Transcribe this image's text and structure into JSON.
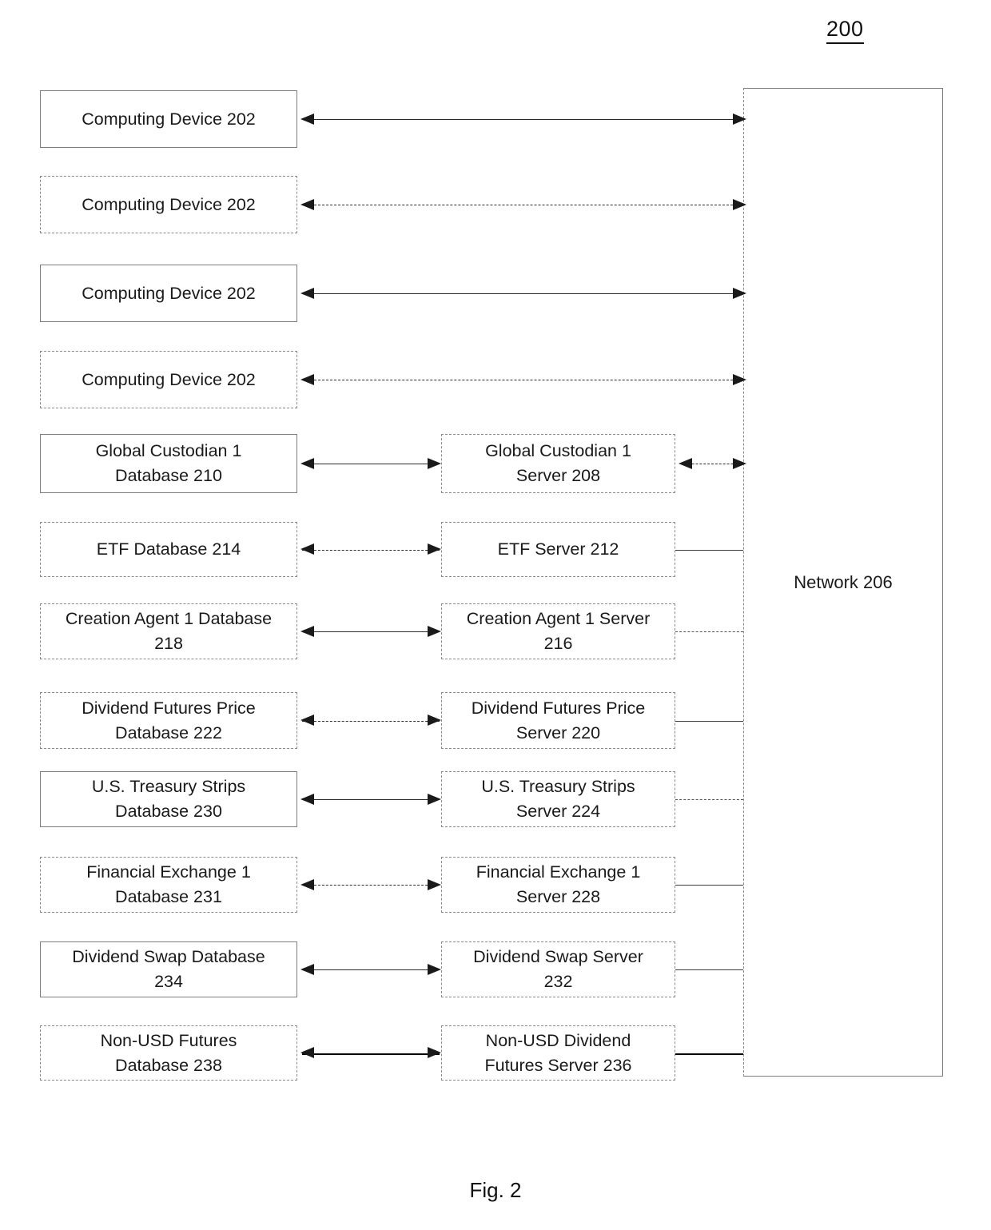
{
  "figure": {
    "reference_numeral": "200",
    "caption": "Fig. 2"
  },
  "network": {
    "label": "Network 206"
  },
  "clients": [
    {
      "label": "Computing Device 202",
      "border": "solid",
      "connector": "solid"
    },
    {
      "label": "Computing Device 202",
      "border": "dashed",
      "connector": "dotted"
    },
    {
      "label": "Computing Device 202",
      "border": "solid",
      "connector": "solid"
    },
    {
      "label": "Computing Device 202",
      "border": "dashed",
      "connector": "dotted"
    }
  ],
  "pairs": [
    {
      "database": "Global Custodian 1\nDatabase 210",
      "server": "Global Custodian 1\nServer 208",
      "db_border": "solid",
      "server_border": "dashed",
      "db_link": "solid",
      "net_link": "arrow-dotted"
    },
    {
      "database": "ETF Database 214",
      "server": "ETF Server 212",
      "db_border": "dashed",
      "server_border": "dashed",
      "db_link": "dotted",
      "net_link": "solid"
    },
    {
      "database": "Creation Agent 1 Database\n218",
      "server": "Creation Agent 1 Server\n216",
      "db_border": "dashed",
      "server_border": "dashed",
      "db_link": "solid",
      "net_link": "dotted"
    },
    {
      "database": "Dividend Futures Price\nDatabase 222",
      "server": "Dividend Futures Price\nServer 220",
      "db_border": "dashed",
      "server_border": "dashed",
      "db_link": "dotted",
      "net_link": "solid"
    },
    {
      "database": "U.S. Treasury Strips\nDatabase 230",
      "server": "U.S. Treasury Strips\nServer 224",
      "db_border": "solid",
      "server_border": "dashed",
      "db_link": "solid",
      "net_link": "dotted"
    },
    {
      "database": "Financial Exchange 1\nDatabase 231",
      "server": "Financial Exchange 1\nServer 228",
      "db_border": "dashed",
      "server_border": "dashed",
      "db_link": "dotted",
      "net_link": "solid"
    },
    {
      "database": "Dividend Swap Database\n234",
      "server": "Dividend Swap Server\n232",
      "db_border": "solid",
      "server_border": "dashed",
      "db_link": "solid",
      "net_link": "solid"
    },
    {
      "database": "Non-USD Futures\nDatabase 238",
      "server": "Non-USD Dividend\nFutures Server 236",
      "db_border": "dashed",
      "server_border": "dashed",
      "db_link": "heavy",
      "net_link": "heavy"
    }
  ]
}
